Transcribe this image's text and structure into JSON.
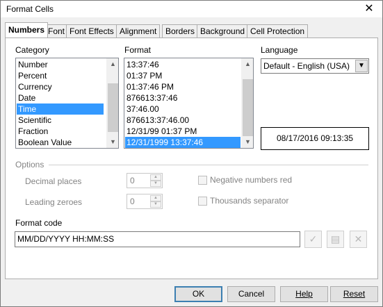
{
  "window": {
    "title": "Format Cells",
    "close_glyph": "✕"
  },
  "tabs": [
    {
      "label": "Numbers",
      "active": true
    },
    {
      "label": "Font"
    },
    {
      "label": "Font Effects"
    },
    {
      "label": "Alignment"
    },
    {
      "label": "Borders"
    },
    {
      "label": "Background"
    },
    {
      "label": "Cell Protection"
    }
  ],
  "category": {
    "label": "Category",
    "items": [
      "Number",
      "Percent",
      "Currency",
      "Date",
      "Time",
      "Scientific",
      "Fraction",
      "Boolean Value"
    ],
    "selected": "Time"
  },
  "format": {
    "label": "Format",
    "items": [
      "13:37:46",
      "01:37 PM",
      "01:37:46 PM",
      "876613:37:46",
      "37:46.00",
      "876613:37:46.00",
      "12/31/99 01:37 PM",
      "12/31/1999 13:37:46"
    ],
    "selected": "12/31/1999 13:37:46"
  },
  "language": {
    "label": "Language",
    "value": "Default - English (USA)"
  },
  "preview": {
    "text": "08/17/2016 09:13:35"
  },
  "options": {
    "label": "Options",
    "decimal_places": {
      "label": "Decimal places",
      "value": "0"
    },
    "leading_zeroes": {
      "label": "Leading zeroes",
      "value": "0"
    },
    "negative_red": {
      "label": "Negative numbers red",
      "checked": false
    },
    "thousands_sep": {
      "label": "Thousands separator",
      "checked": false
    }
  },
  "format_code": {
    "label": "Format code",
    "value": "MM/DD/YYYY HH:MM:SS"
  },
  "format_code_buttons": {
    "apply_icon": "checkmark-icon",
    "comment_icon": "note-icon",
    "delete_icon": "delete-icon"
  },
  "buttons": {
    "ok": "OK",
    "cancel": "Cancel",
    "help": "Help",
    "reset": "Reset"
  },
  "colors": {
    "selection": "#3399ff",
    "default_button_border": "#3c7fb1"
  }
}
